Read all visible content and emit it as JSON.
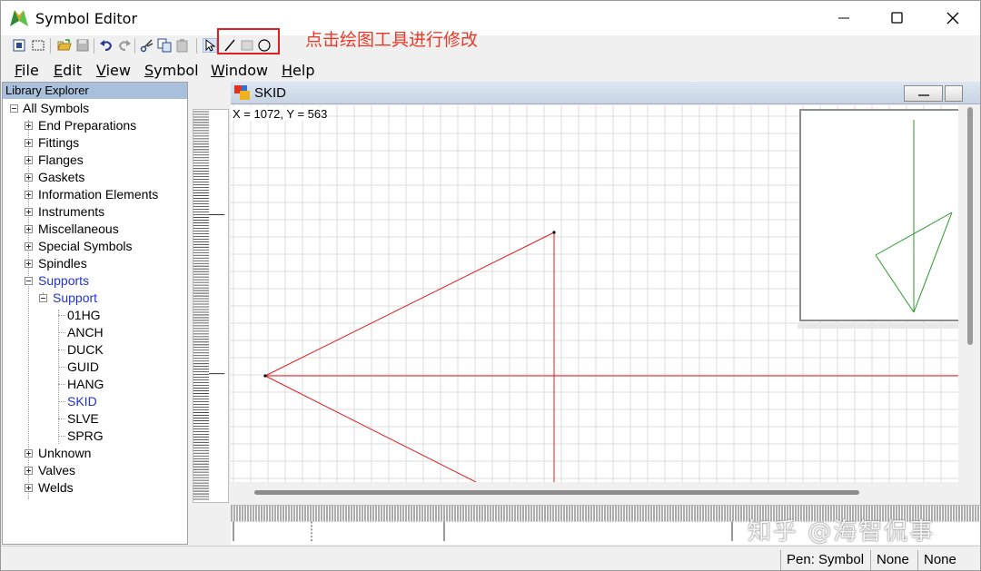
{
  "window": {
    "title": "Symbol Editor"
  },
  "toolbar": {
    "tools": [
      "new-icon",
      "select-area-icon",
      "open-icon",
      "save-icon",
      "undo-icon",
      "redo-icon",
      "cut-icon",
      "copy-icon",
      "paste-icon",
      "pointer-icon",
      "line-icon",
      "rectangle-icon",
      "ellipse-icon"
    ]
  },
  "annotation": {
    "text": "点击绘图工具进行修改",
    "color": "#e83a28"
  },
  "menu": [
    {
      "label": "File",
      "mnemonic": "F",
      "rest": "ile"
    },
    {
      "label": "Edit",
      "mnemonic": "E",
      "rest": "dit"
    },
    {
      "label": "View",
      "mnemonic": "V",
      "rest": "iew"
    },
    {
      "label": "Symbol",
      "mnemonic": "S",
      "rest": "ymbol"
    },
    {
      "label": "Window",
      "mnemonic": "W",
      "rest": "indow"
    },
    {
      "label": "Help",
      "mnemonic": "H",
      "rest": "elp"
    }
  ],
  "explorer": {
    "header": "Library Explorer",
    "root": "All Symbols",
    "categories": [
      "End Preparations",
      "Fittings",
      "Flanges",
      "Gaskets",
      "Information Elements",
      "Instruments",
      "Miscellaneous",
      "Special Symbols",
      "Spindles",
      "Supports"
    ],
    "support_group": "Support",
    "support_items": [
      "01HG",
      "ANCH",
      "DUCK",
      "GUID",
      "HANG",
      "SKID",
      "SLVE",
      "SPRG"
    ],
    "selected": "SKID",
    "after": [
      "Unknown",
      "Valves",
      "Welds"
    ]
  },
  "editor": {
    "title": "SKID",
    "coords": "X = 1072, Y = 563",
    "shape_color": "#e02020",
    "preview_color": "#2a9a2a"
  },
  "status": {
    "pen": "Pen: Symbol",
    "field2": "None",
    "field3": "None"
  },
  "watermark": "知乎 @海智侃事"
}
